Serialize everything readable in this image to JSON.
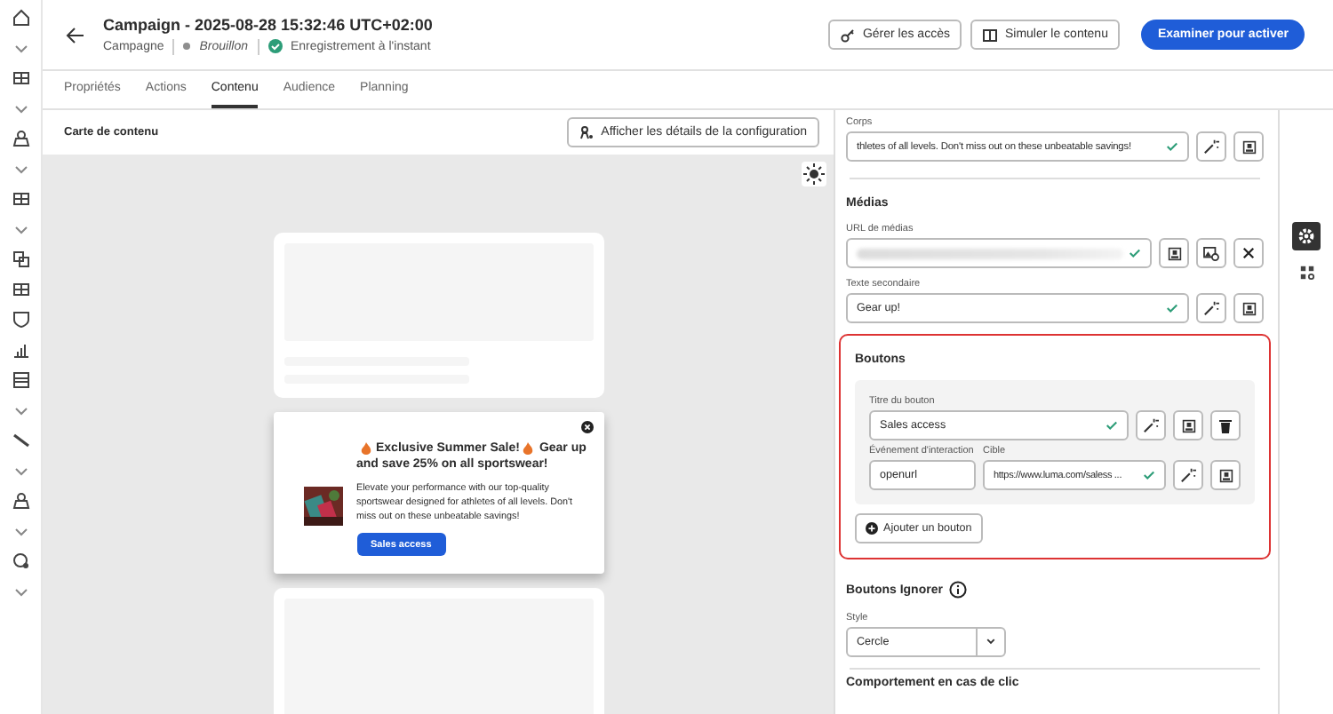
{
  "header": {
    "title": "Campaign - 2025-08-28 15:32:46 UTC+02:00",
    "type": "Campagne",
    "status": "Brouillon",
    "save_state": "Enregistrement à l'instant",
    "saved": true,
    "actions": [
      {
        "label": "Gérer les accès",
        "kind": "access"
      },
      {
        "label": "Simuler le contenu",
        "kind": "simulate"
      }
    ],
    "primary": "Examiner pour activer"
  },
  "tabs": [
    {
      "label": "Propriétés",
      "selected": false
    },
    {
      "label": "Actions",
      "selected": false
    },
    {
      "label": "Contenu",
      "selected": true
    },
    {
      "label": "Audience",
      "selected": false
    },
    {
      "label": "Planning",
      "selected": false
    }
  ],
  "canvas": {
    "title": "Carte de contenu",
    "config_button": "Afficher les détails de la configuration",
    "card": {
      "title_lines": [
        "Exclusive Summer Sale!",
        "Gear up",
        "and save 25% on all sportswear!"
      ],
      "body": "Elevate your performance with our top-quality sportswear designed for athletes of all levels. Don't miss out on these unbeatable savings!",
      "button": "Sales access"
    }
  },
  "panel": {
    "body_field": {
      "label": "Corps",
      "value": "thletes of all levels. Don't miss out on these unbeatable savings!",
      "valid": true
    },
    "media": {
      "title": "Médias",
      "url_label": "URL de médias",
      "url_valid": true,
      "alt_label": "Texte secondaire",
      "alt_value": "Gear up!",
      "alt_valid": true
    },
    "buttons": {
      "title": "Boutons",
      "highlighted": true,
      "title_label": "Titre du bouton",
      "title_value": "Sales access",
      "title_valid": true,
      "event_label": "Événement d'interaction",
      "event_value": "openurl",
      "target_label": "Cible",
      "target_value": "https://www.luma.com/saless ...",
      "target_valid": true,
      "add": "Ajouter un bouton"
    },
    "dismiss": {
      "title": "Boutons Ignorer",
      "style_label": "Style",
      "style_value": "Cercle"
    },
    "next_section": "Comportement en cas de clic"
  },
  "rail_tabs": [
    {
      "kind": "settings",
      "selected": true
    },
    {
      "kind": "layout",
      "selected": false
    }
  ]
}
